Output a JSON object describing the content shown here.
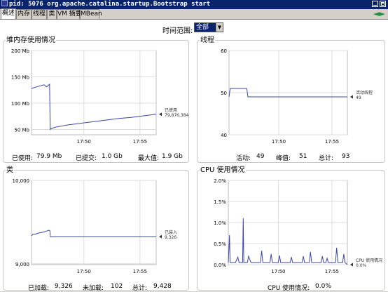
{
  "window": {
    "title": "pid: 5076 org.apache.catalina.startup.Bootstrap start"
  },
  "tabs": [
    {
      "label": "概述",
      "active": true
    },
    {
      "label": "内存",
      "active": false
    },
    {
      "label": "线程",
      "active": false
    },
    {
      "label": "类",
      "active": false
    },
    {
      "label": "VM 摘要",
      "active": false
    },
    {
      "label": "MBean",
      "active": false
    }
  ],
  "time_range": {
    "label": "时间范围:",
    "value": "全部"
  },
  "panels": {
    "heap": {
      "title": "堆内存使用情况",
      "stats": {
        "used_label": "已使用:",
        "used_value": "79.9  Mb",
        "committed_label": "已提交:",
        "committed_value": "1.0  Gb",
        "max_label": "最大值:",
        "max_value": "1.9  Gb"
      }
    },
    "threads": {
      "title": "线程",
      "stats": {
        "live_label": "活动:",
        "live_value": "49",
        "peak_label": "峰值:",
        "peak_value": "51",
        "total_label": "总计:",
        "total_value": "93"
      }
    },
    "classes": {
      "title": "类",
      "stats": {
        "loaded_label": "已加载:",
        "loaded_value": "9,326",
        "unloaded_label": "未加载:",
        "unloaded_value": "102",
        "total_label": "总计:",
        "total_value": "9,428"
      }
    },
    "cpu": {
      "title": "CPU 使用情况",
      "stats": {
        "usage_label": "CPU 使用情况:",
        "usage_value": "0.0%"
      }
    }
  },
  "chart_data": [
    {
      "type": "line",
      "title": "堆内存使用情况",
      "yticks": [
        "200  Mb",
        "150  Mb",
        "100  Mb",
        "50  Mb"
      ],
      "ylim": [
        40,
        200
      ],
      "xticks": [
        "17:50",
        "17:55"
      ],
      "xlim": [
        0,
        1
      ],
      "x": [
        0.0,
        0.04,
        0.1,
        0.12,
        0.145,
        0.15,
        0.16,
        0.2,
        0.3,
        0.4,
        0.5,
        0.6,
        0.7,
        0.8,
        0.9,
        1.0
      ],
      "series": [
        {
          "values": [
            128,
            131,
            135,
            131,
            136,
            50,
            52,
            55,
            59,
            62,
            65,
            68,
            71,
            73,
            76,
            79
          ]
        }
      ],
      "legend": {
        "label": "已使用",
        "value": "79,876,384"
      },
      "series_color": "#3b46a8"
    },
    {
      "type": "line",
      "title": "线程",
      "yticks": [
        "60",
        "50",
        "40"
      ],
      "ylim": [
        40,
        60
      ],
      "xticks": [
        "17:50",
        "17:55"
      ],
      "xlim": [
        0,
        1
      ],
      "x": [
        0.0,
        0.01,
        0.02,
        0.15,
        0.16,
        0.17,
        1.0
      ],
      "series": [
        {
          "values": [
            49,
            51,
            51,
            51,
            49,
            49,
            49
          ]
        }
      ],
      "legend": {
        "label": "活动线程",
        "value": "49"
      },
      "series_color": "#3b46a8"
    },
    {
      "type": "line",
      "title": "类",
      "yticks": [
        "10,000",
        "9,000"
      ],
      "ylim": [
        8990,
        10000
      ],
      "xticks": [
        "17:50",
        "17:55"
      ],
      "xlim": [
        0,
        1
      ],
      "x": [
        0.0,
        0.01,
        0.03,
        0.06,
        0.09,
        0.12,
        0.14,
        0.148,
        0.15,
        1.0
      ],
      "series": [
        {
          "values": [
            9335,
            9352,
            9355,
            9370,
            9378,
            9392,
            9402,
            9395,
            9326,
            9326
          ]
        }
      ],
      "legend": {
        "label": "已装入",
        "value": "9,326"
      },
      "series_color": "#3b46a8"
    },
    {
      "type": "line",
      "title": "CPU 使用情况",
      "yticks": [
        "2.0%",
        "1.5%",
        "1.0%",
        "0.5%",
        "0.0%"
      ],
      "ylim": [
        0,
        2.0
      ],
      "xticks": [
        "17:50",
        "17:55"
      ],
      "xlim": [
        0,
        1
      ],
      "x": [
        0.0,
        0.01,
        0.015,
        0.02,
        0.03,
        0.06,
        0.08,
        0.09,
        0.1,
        0.12,
        0.125,
        0.13,
        0.14,
        0.16,
        0.17,
        0.19,
        0.2,
        0.27,
        0.28,
        0.29,
        0.35,
        0.36,
        0.37,
        0.42,
        0.43,
        0.44,
        0.52,
        0.53,
        0.54,
        0.62,
        0.63,
        0.64,
        0.68,
        0.69,
        0.7,
        0.78,
        0.79,
        0.8,
        0.82,
        0.83,
        0.84,
        0.9,
        0.91,
        0.92,
        0.96,
        0.97,
        0.98,
        1.0
      ],
      "series": [
        {
          "values": [
            0.05,
            0.7,
            0.05,
            0.05,
            0.05,
            0.05,
            0.18,
            0.05,
            0.05,
            0.05,
            1.1,
            0.05,
            0.05,
            0.05,
            0.2,
            0.05,
            0.05,
            0.05,
            0.33,
            0.05,
            0.05,
            0.25,
            0.05,
            0.05,
            0.22,
            0.05,
            0.05,
            0.18,
            0.05,
            0.05,
            0.2,
            0.05,
            0.05,
            0.3,
            0.05,
            0.05,
            0.2,
            0.05,
            0.05,
            0.15,
            0.05,
            0.05,
            0.4,
            0.05,
            0.05,
            0.25,
            0.05,
            0.0
          ]
        }
      ],
      "legend": {
        "label": "CPU 使用情况",
        "value": "0.0%"
      },
      "series_color": "#3b46a8"
    }
  ]
}
